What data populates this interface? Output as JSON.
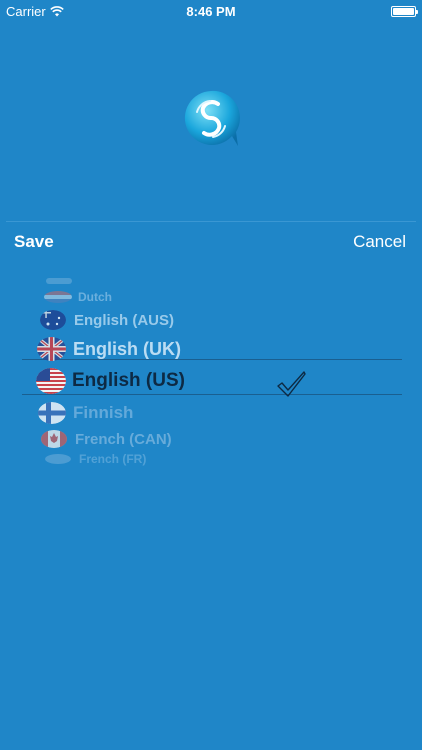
{
  "status_bar": {
    "carrier": "Carrier",
    "time": "8:46 PM"
  },
  "toolbar": {
    "save_label": "Save",
    "cancel_label": "Cancel"
  },
  "picker": {
    "selected": "English (US)",
    "items": [
      {
        "label": "Dutch",
        "flag": "netherlands-flag-icon"
      },
      {
        "label": "English (AUS)",
        "flag": "australia-flag-icon"
      },
      {
        "label": "English (UK)",
        "flag": "uk-flag-icon"
      },
      {
        "label": "English (US)",
        "flag": "us-flag-icon"
      },
      {
        "label": "Finnish",
        "flag": "finland-flag-icon"
      },
      {
        "label": "French (CAN)",
        "flag": "canada-flag-icon"
      },
      {
        "label": "French (FR)",
        "flag": "france-flag-icon"
      }
    ]
  },
  "colors": {
    "background": "#1f86c8",
    "selected_text": "#0d2a44",
    "faded_text": "#7fb8e0"
  }
}
